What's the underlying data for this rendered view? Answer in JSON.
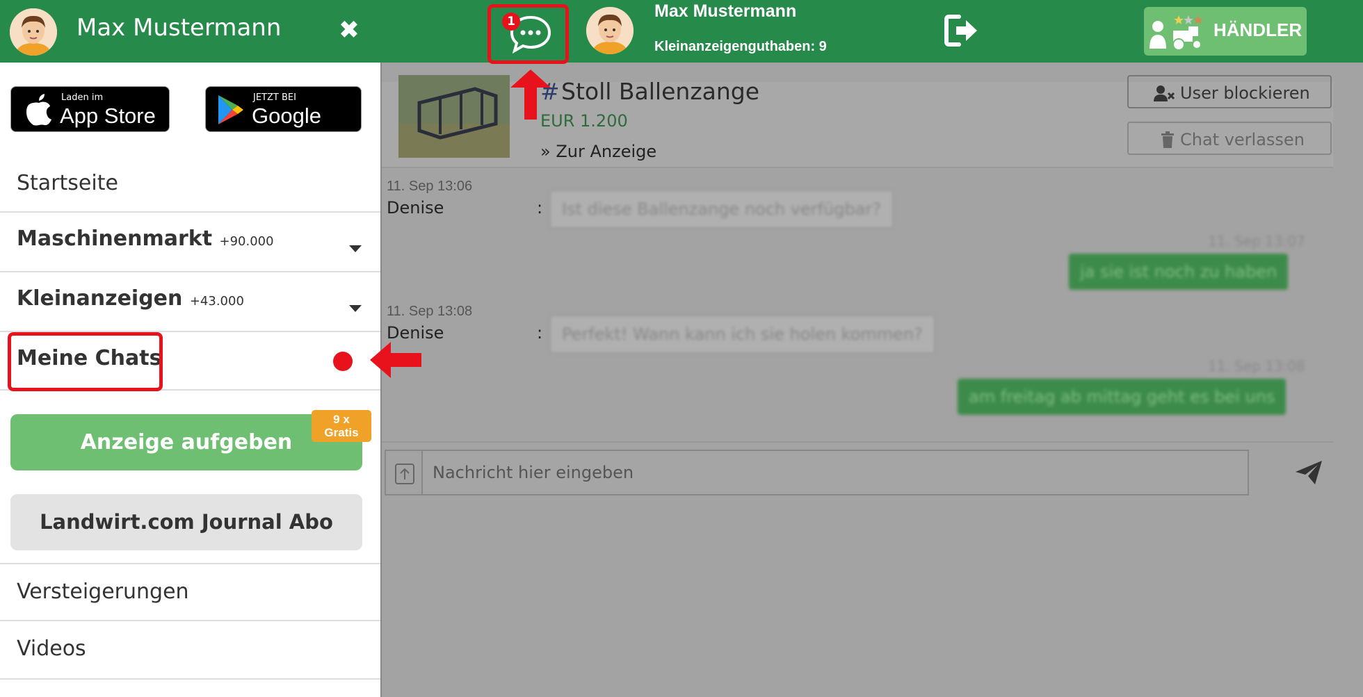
{
  "drawer": {
    "user_name": "Max Mustermann",
    "close_label": "✖",
    "appstore": {
      "small": "Laden im",
      "big": "App Store"
    },
    "googleplay": {
      "small": "JETZT BEI",
      "big": "Google Play"
    },
    "menu": [
      {
        "label": "Startseite",
        "count": ""
      },
      {
        "label": "Maschinenmarkt",
        "count": "+90.000"
      },
      {
        "label": "Kleinanzeigen",
        "count": "+43.000"
      },
      {
        "label": "Meine Chats",
        "count": ""
      },
      {
        "label": "Versteigerungen",
        "count": ""
      },
      {
        "label": "Videos",
        "count": ""
      }
    ],
    "post_ad_label": "Anzeige aufgeben",
    "gratis_line1": "9 x",
    "gratis_line2": "Gratis",
    "journal_label": "Landwirt.com Journal Abo"
  },
  "topbar": {
    "chat_badge": "1",
    "user_name": "Max Mustermann",
    "credit": "Kleinanzeigenguthaben: 9",
    "dealer_label": "HÄNDLER"
  },
  "chat": {
    "ad_title": "Stoll Ballenzange",
    "ad_hash": "#",
    "ad_price": "EUR 1.200",
    "ad_link": "» Zur Anzeige",
    "block_label": "User blockieren",
    "leave_label": "Chat verlassen",
    "messages": [
      {
        "time": "11. Sep 13:06",
        "name": "Denise",
        "text": "Ist diese Ballenzange noch verfügbar?"
      },
      {
        "time": "11. Sep 13:07",
        "text": "ja sie ist noch zu haben"
      },
      {
        "time": "11. Sep 13:08",
        "name": "Denise",
        "text": "Perfekt! Wann kann ich sie holen kommen?"
      },
      {
        "time": "11. Sep 13:08",
        "text": "am freitag ab mittag geht es bei uns"
      }
    ],
    "input_placeholder": "Nachricht hier eingeben"
  },
  "colors": {
    "brand_green": "#268a4a",
    "accent_red": "#e8121d",
    "button_green": "#6fbf73",
    "badge_orange": "#f0a127"
  },
  "icons": [
    "close-icon",
    "chat-icon",
    "logout-icon",
    "dealer-icon",
    "apple-icon",
    "google-play-icon",
    "chevron-down-icon",
    "user-block-icon",
    "trash-icon",
    "upload-icon",
    "send-icon"
  ]
}
